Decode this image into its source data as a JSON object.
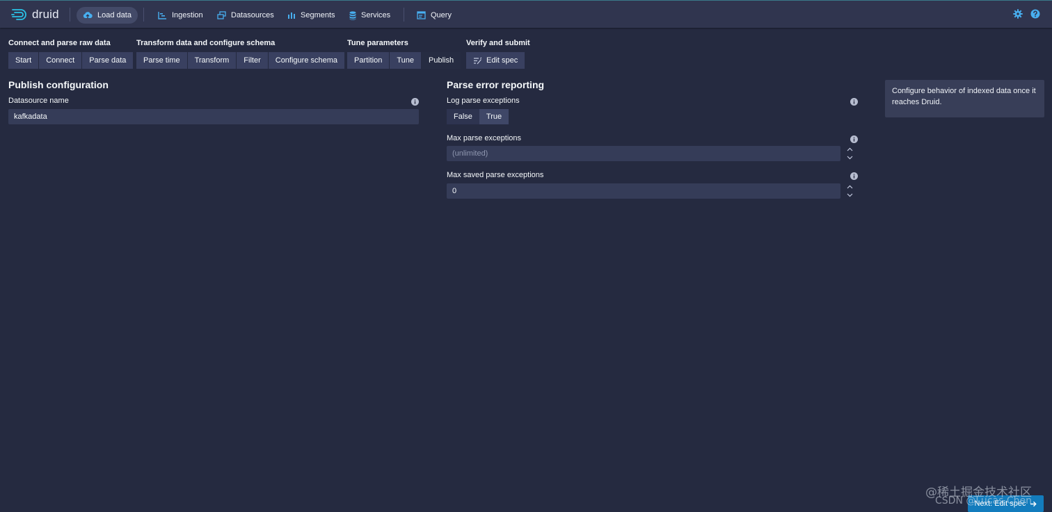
{
  "nav": {
    "brand": "druid",
    "items": [
      {
        "label": "Load data",
        "icon": "cloud-upload-icon"
      },
      {
        "label": "Ingestion",
        "icon": "gantt-chart-icon"
      },
      {
        "label": "Datasources",
        "icon": "multi-select-icon"
      },
      {
        "label": "Segments",
        "icon": "stacked-chart-icon"
      },
      {
        "label": "Services",
        "icon": "database-icon"
      },
      {
        "label": "Query",
        "icon": "application-icon"
      }
    ],
    "right_icons": [
      "cog-icon",
      "help-icon"
    ]
  },
  "steps": {
    "groups": [
      {
        "label": "Connect and parse raw data",
        "buttons": [
          "Start",
          "Connect",
          "Parse data"
        ]
      },
      {
        "label": "Transform data and configure schema",
        "buttons": [
          "Parse time",
          "Transform",
          "Filter",
          "Configure schema"
        ]
      },
      {
        "label": "Tune parameters",
        "buttons": [
          "Partition",
          "Tune",
          "Publish"
        ]
      },
      {
        "label": "Verify and submit",
        "buttons": [
          "Edit spec"
        ]
      }
    ],
    "active": "Publish"
  },
  "publish": {
    "title": "Publish configuration",
    "datasource_label": "Datasource name",
    "datasource_value": "kafkadata"
  },
  "parse_errors": {
    "title": "Parse error reporting",
    "log_label": "Log parse exceptions",
    "log_options": [
      "False",
      "True"
    ],
    "log_selected": "True",
    "max_label": "Max parse exceptions",
    "max_placeholder": "(unlimited)",
    "max_saved_label": "Max saved parse exceptions",
    "max_saved_value": "0"
  },
  "help_text": "Configure behavior of indexed data once it reaches Druid.",
  "next_button": "Next: Edit spec",
  "watermark": {
    "line1": "@稀土掘金技术社区",
    "line2": "CSDN @Lucas Chen"
  },
  "colors": {
    "background": "#252a40",
    "navbar": "#30354f",
    "accent": "#48aff0",
    "primary": "#137cbd"
  }
}
